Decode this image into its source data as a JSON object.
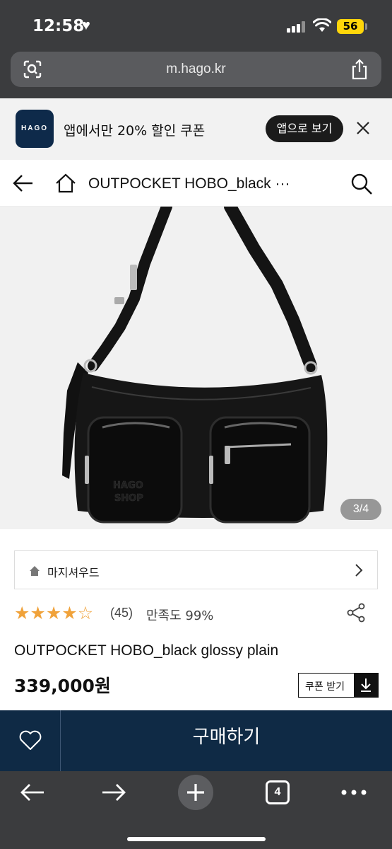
{
  "status_bar": {
    "time": "12:58",
    "battery": "56"
  },
  "browser": {
    "url": "m.hago.kr",
    "tab_count": "4"
  },
  "app_banner": {
    "logo_text": "HAGO",
    "promo_text": "앱에서만 20% 할인 쿠폰",
    "open_app_label": "앱으로 보기"
  },
  "header": {
    "title": "OUTPOCKET HOBO_black ···"
  },
  "gallery": {
    "counter": "3/4"
  },
  "brand": {
    "name": "마지셔우드"
  },
  "rating": {
    "stars": 4.5,
    "count": "(45)",
    "satisfaction": "만족도 99%"
  },
  "product": {
    "name": "OUTPOCKET HOBO_black glossy plain",
    "price": "339,000원",
    "coupon_label": "쿠폰 받기"
  },
  "purchase_bar": {
    "buy_label": "구매하기"
  },
  "colors": {
    "browser_chrome": "#3b3c3e",
    "navy": "#0f2a45",
    "star": "#f0a23a",
    "battery": "#ffd60a"
  }
}
